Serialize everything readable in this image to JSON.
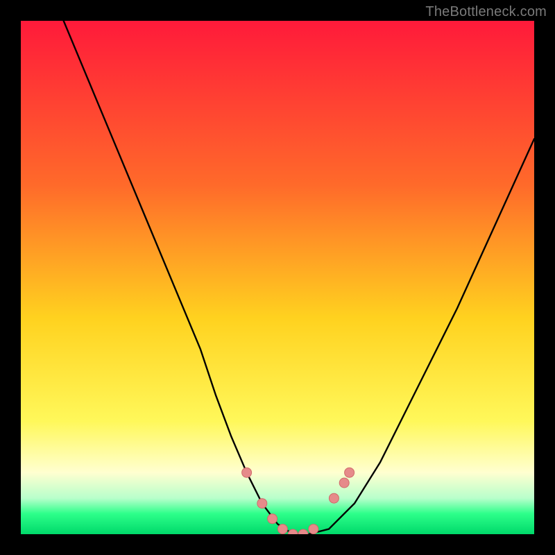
{
  "watermark": "TheBottleneck.com",
  "colors": {
    "top": "#ff1a3a",
    "mid_upper": "#ff6a2a",
    "mid": "#ffd21f",
    "mid_lower": "#fff85a",
    "pale": "#ffffd0",
    "green_light": "#b8ffcb",
    "green": "#2dff8a",
    "green_deep": "#00d96a",
    "curve": "#000000",
    "marker": "#e68a8a",
    "marker_stroke": "#d06a6a"
  },
  "chart_data": {
    "type": "line",
    "title": "",
    "xlabel": "",
    "ylabel": "",
    "xlim": [
      0,
      100
    ],
    "ylim": [
      0,
      100
    ],
    "series": [
      {
        "name": "bottleneck-curve",
        "x": [
          0,
          5,
          10,
          15,
          20,
          25,
          30,
          35,
          38,
          41,
          44,
          47,
          50,
          53,
          56,
          60,
          65,
          70,
          75,
          80,
          85,
          90,
          95,
          100
        ],
        "y": [
          120,
          108,
          96,
          84,
          72,
          60,
          48,
          36,
          27,
          19,
          12,
          6,
          2,
          0,
          0,
          1,
          6,
          14,
          24,
          34,
          44,
          55,
          66,
          77
        ]
      }
    ],
    "markers": {
      "name": "highlight-points",
      "points": [
        {
          "x": 44,
          "y": 12
        },
        {
          "x": 47,
          "y": 6
        },
        {
          "x": 49,
          "y": 3
        },
        {
          "x": 51,
          "y": 1
        },
        {
          "x": 53,
          "y": 0
        },
        {
          "x": 55,
          "y": 0
        },
        {
          "x": 57,
          "y": 1
        },
        {
          "x": 61,
          "y": 7
        },
        {
          "x": 63,
          "y": 10
        },
        {
          "x": 64,
          "y": 12
        }
      ]
    },
    "grid": false,
    "legend": false
  }
}
